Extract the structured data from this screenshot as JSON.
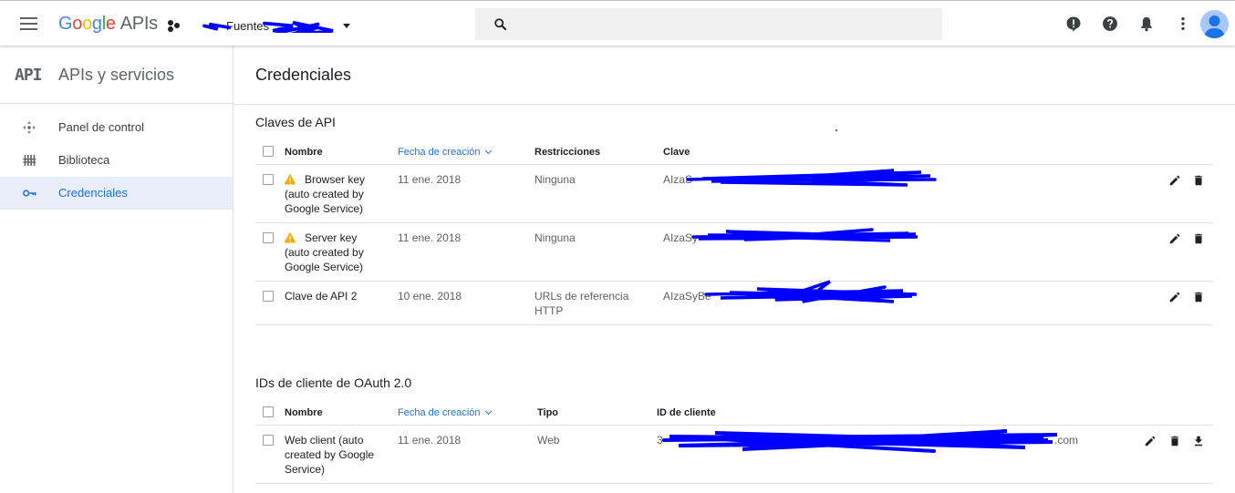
{
  "header": {
    "logo": {
      "g": "G",
      "o1": "o",
      "o2": "o",
      "g2": "g",
      "l": "l",
      "e": "e",
      "apis": "APIs"
    },
    "project_name": "Fuentes",
    "search_placeholder": "",
    "icons": [
      "menu-icon",
      "search-icon",
      "alert-icon",
      "help-icon",
      "notifications-icon",
      "more-vert-icon",
      "account-icon"
    ]
  },
  "sidebar": {
    "mark": "API",
    "title": "APIs y servicios",
    "items": [
      {
        "label": "Panel de control",
        "icon": "dashboard-icon"
      },
      {
        "label": "Biblioteca",
        "icon": "library-icon"
      },
      {
        "label": "Credenciales",
        "icon": "key-icon",
        "active": true
      }
    ]
  },
  "main": {
    "title": "Credenciales",
    "api_keys": {
      "section_title": "Claves de API",
      "columns": {
        "name": "Nombre",
        "date": "Fecha de creación",
        "restrictions": "Restricciones",
        "key": "Clave"
      },
      "rows": [
        {
          "name": [
            "Browser key",
            "(auto created by",
            "Google Service)"
          ],
          "warning": true,
          "date": "11 ene. 2018",
          "restrictions": [
            "Ninguna"
          ],
          "key": "AIzaS"
        },
        {
          "name": [
            "Server key",
            "(auto created by",
            "Google Service)"
          ],
          "warning": true,
          "date": "11 ene. 2018",
          "restrictions": [
            "Ninguna"
          ],
          "key": "AIzaSy"
        },
        {
          "name": [
            "Clave de API 2"
          ],
          "warning": false,
          "date": "10 ene. 2018",
          "restrictions": [
            "URLs de referencia",
            "HTTP"
          ],
          "key": "AIzaSyBe"
        }
      ]
    },
    "oauth": {
      "section_title": "IDs de cliente de OAuth 2.0",
      "columns": {
        "name": "Nombre",
        "date": "Fecha de creación",
        "type": "Tipo",
        "client_id": "ID de cliente"
      },
      "rows": [
        {
          "name": [
            "Web client (auto",
            "created by Google",
            "Service)"
          ],
          "date": "11 ene. 2018",
          "type": "Web",
          "client_id_prefix": "3",
          "client_id_suffix": ".com"
        }
      ]
    }
  },
  "colors": {
    "accent": "#1a73e8",
    "redaction": "#0000ff",
    "warning": "#f9ab00",
    "active_bg": "#e8eef9"
  }
}
